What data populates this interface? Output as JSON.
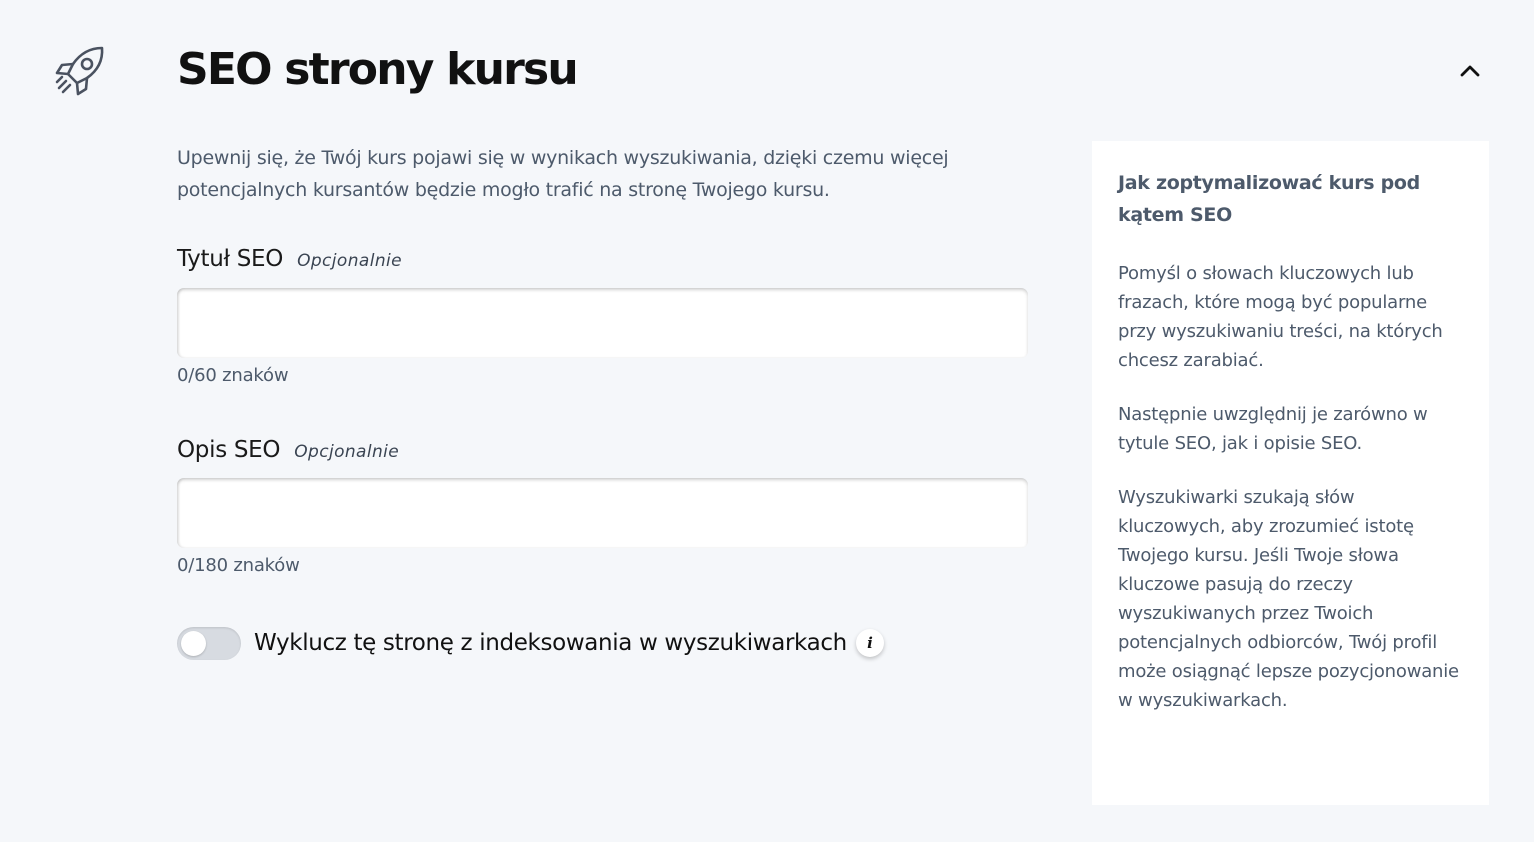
{
  "section": {
    "title": "SEO strony kursu",
    "description": "Upewnij się, że Twój kurs pojawi się w wynikach wyszukiwania, dzięki czemu więcej potencjalnych kursantów będzie mogło trafić na stronę Twojego kursu.",
    "icon": "rocket-icon",
    "collapse_icon": "chevron-up-icon"
  },
  "seo_title": {
    "label": "Tytuł SEO",
    "optional": "Opcjonalnie",
    "value": "",
    "counter": "0/60 znaków"
  },
  "seo_description": {
    "label": "Opis SEO",
    "optional": "Opcjonalnie",
    "value": "",
    "counter": "0/180 znaków"
  },
  "exclude_indexing": {
    "label": "Wyklucz tę stronę z indeksowania w wyszukiwarkach",
    "checked": false,
    "info_icon": "info-icon",
    "info_glyph": "i"
  },
  "help_panel": {
    "heading": "Jak zoptymalizować kurs pod kątem SEO",
    "paragraphs": [
      "Pomyśl o słowach kluczowych lub frazach, które mogą być popularne przy wyszukiwaniu treści, na których chcesz zarabiać.",
      "Następnie uwzględnij je zarówno w tytule SEO, jak i opisie SEO.",
      "Wyszukiwarki szukają słów kluczowych, aby zrozumieć istotę Twojego kursu. Jeśli Twoje słowa kluczowe pasują do rzeczy wyszukiwanych przez Twoich potencjalnych odbiorców, Twój profil może osiągnąć lepsze pozycjonowanie w wyszukiwarkach."
    ]
  },
  "colors": {
    "background": "#f5f7fa",
    "muted_text": "#4d5a6b",
    "toggle_off": "#d7dbe1"
  }
}
